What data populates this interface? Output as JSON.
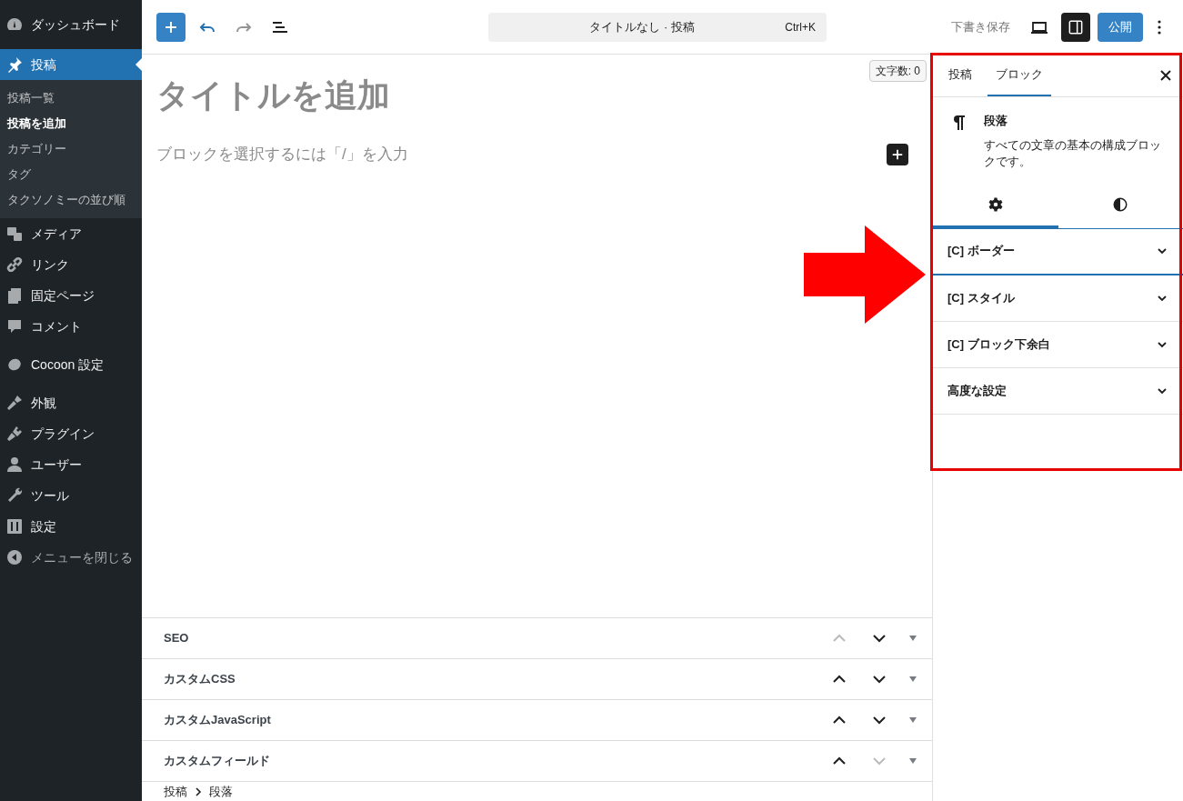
{
  "sidebar": {
    "items": [
      {
        "label": "ダッシュボード",
        "selected": false
      },
      {
        "label": "投稿",
        "selected": true,
        "children": [
          {
            "label": "投稿一覧",
            "selected": false
          },
          {
            "label": "投稿を追加",
            "selected": true
          },
          {
            "label": "カテゴリー",
            "selected": false
          },
          {
            "label": "タグ",
            "selected": false
          },
          {
            "label": "タクソノミーの並び順",
            "selected": false
          }
        ]
      },
      {
        "label": "メディア",
        "selected": false
      },
      {
        "label": "リンク",
        "selected": false
      },
      {
        "label": "固定ページ",
        "selected": false
      },
      {
        "label": "コメント",
        "selected": false
      },
      {
        "label": "Cocoon 設定",
        "selected": false
      },
      {
        "label": "外観",
        "selected": false
      },
      {
        "label": "プラグイン",
        "selected": false
      },
      {
        "label": "ユーザー",
        "selected": false
      },
      {
        "label": "ツール",
        "selected": false
      },
      {
        "label": "設定",
        "selected": false
      }
    ],
    "collapse": "メニューを閉じる"
  },
  "toolbar": {
    "command": "タイトルなし · 投稿",
    "shortcut": "Ctrl+K",
    "save_draft": "下書き保存",
    "settings_pressed": true,
    "publish": "公開"
  },
  "editor": {
    "word_count": "文字数: 0",
    "title_placeholder": "タイトルを追加",
    "block_placeholder": "ブロックを選択するには「/」を入力"
  },
  "meta_boxes": [
    {
      "title": "SEO",
      "up_disabled": true,
      "down_disabled": false
    },
    {
      "title": "カスタムCSS",
      "up_disabled": false,
      "down_disabled": false
    },
    {
      "title": "カスタムJavaScript",
      "up_disabled": false,
      "down_disabled": false
    },
    {
      "title": "カスタムフィールド",
      "up_disabled": false,
      "down_disabled": true
    }
  ],
  "breadcrumb": [
    "投稿",
    "段落"
  ],
  "panel": {
    "tabs": [
      {
        "label": "投稿",
        "selected": false
      },
      {
        "label": "ブロック",
        "selected": true
      }
    ],
    "block": {
      "name": "段落",
      "description": "すべての文章の基本の構成ブロックです。"
    },
    "subtabs": [
      {
        "selected": true
      },
      {
        "selected": false
      }
    ],
    "sections": [
      {
        "title": "[C] ボーダー",
        "focused": true
      },
      {
        "title": "[C] スタイル",
        "focused": false
      },
      {
        "title": "[C] ブロック下余白",
        "focused": false
      },
      {
        "title": "高度な設定",
        "focused": false
      }
    ]
  }
}
